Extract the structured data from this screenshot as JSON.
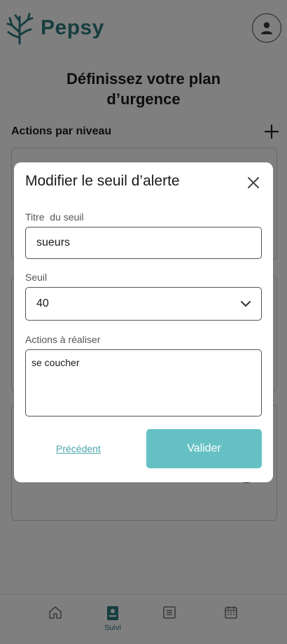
{
  "app": {
    "name": "Pepsy",
    "brand_color": "#2e7d80",
    "accent_color": "#66c1c5"
  },
  "header": {
    "profile_icon": "user-icon"
  },
  "page": {
    "title_line1": "Définissez votre plan",
    "title_line2": "d’urgence",
    "section_label": "Actions par niveau",
    "add_icon": "plus-icon"
  },
  "modal": {
    "title": "Modifier le seuil d’alerte",
    "close_icon": "close-icon",
    "fields": {
      "title_label": "Titre  du seuil",
      "title_value": "sueurs",
      "threshold_label": "Seuil",
      "threshold_value": "40",
      "actions_label": "Actions à réaliser",
      "actions_value": "se coucher"
    },
    "previous_label": "Précédent",
    "submit_label": "Valider"
  },
  "nav": {
    "items": [
      {
        "icon": "home-icon",
        "label": ""
      },
      {
        "icon": "tracking-icon",
        "label": "Suivi"
      },
      {
        "icon": "list-icon",
        "label": ""
      },
      {
        "icon": "calendar-icon",
        "label": ""
      }
    ]
  }
}
